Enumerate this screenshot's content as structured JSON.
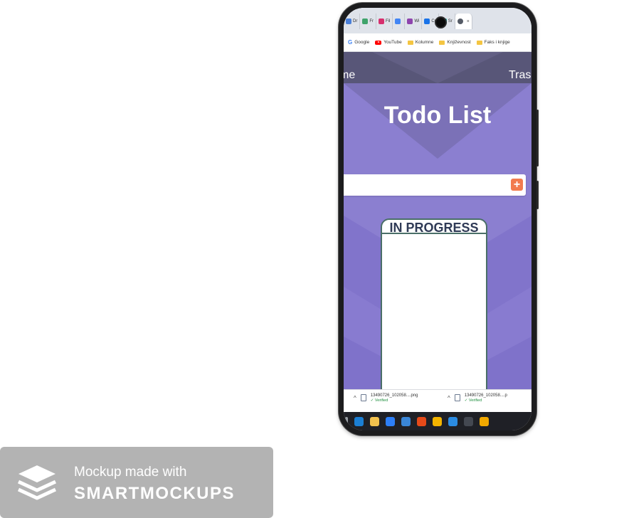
{
  "browser": {
    "tabs": [
      {
        "label": "Dr",
        "icon": "app-icon",
        "color": "#4a7fd8"
      },
      {
        "label": "Fr",
        "icon": "app-icon",
        "color": "#3fa36b"
      },
      {
        "label": "Fil",
        "icon": "instagram-icon",
        "color": "#d6306e"
      },
      {
        "label": "",
        "icon": "google-icon",
        "color": "#4285f4"
      },
      {
        "label": "Wi",
        "icon": "app-icon",
        "color": "#8e44ad"
      },
      {
        "label": "Cr",
        "icon": "app-icon",
        "color": "#1a73e8"
      },
      {
        "label": "Sr",
        "icon": "app-icon",
        "color": "#1aa39a"
      }
    ],
    "active_tab_close": "×",
    "bookmarks": [
      {
        "label": "Google",
        "icon": "google-icon"
      },
      {
        "label": "YouTube",
        "icon": "youtube-icon"
      },
      {
        "label": "Kolumne",
        "icon": "folder-icon"
      },
      {
        "label": "Književnost",
        "icon": "folder-icon"
      },
      {
        "label": "Faks i knjige",
        "icon": "folder-icon"
      }
    ]
  },
  "app": {
    "nav_left": "me",
    "nav_right": "Tras",
    "title": "Todo List",
    "add_button_glyph": "+",
    "column_title": "IN PROGRESS",
    "accent_color": "#f27b4e",
    "background_color": "#8b7fd0"
  },
  "downloads": [
    {
      "filename": "13490726_102058....png",
      "status": "Verified"
    },
    {
      "filename": "13490726_102058....p",
      "status": "Verified"
    }
  ],
  "taskbar": {
    "icons": [
      {
        "name": "edge-icon",
        "color": "#1b7fd4"
      },
      {
        "name": "file-explorer-icon",
        "color": "#f2c14e"
      },
      {
        "name": "store-icon",
        "color": "#2d7ff9"
      },
      {
        "name": "mail-icon",
        "color": "#3a86d8"
      },
      {
        "name": "office-icon",
        "color": "#e64a19"
      },
      {
        "name": "chrome-icon",
        "color": "#f4b400"
      },
      {
        "name": "vscode-icon",
        "color": "#2b8ce3"
      },
      {
        "name": "terminal-icon",
        "color": "#444851"
      },
      {
        "name": "chrome-canary-icon",
        "color": "#f2a900"
      }
    ]
  },
  "badge": {
    "line1": "Mockup made with",
    "line2": "SMARTMOCKUPS"
  }
}
